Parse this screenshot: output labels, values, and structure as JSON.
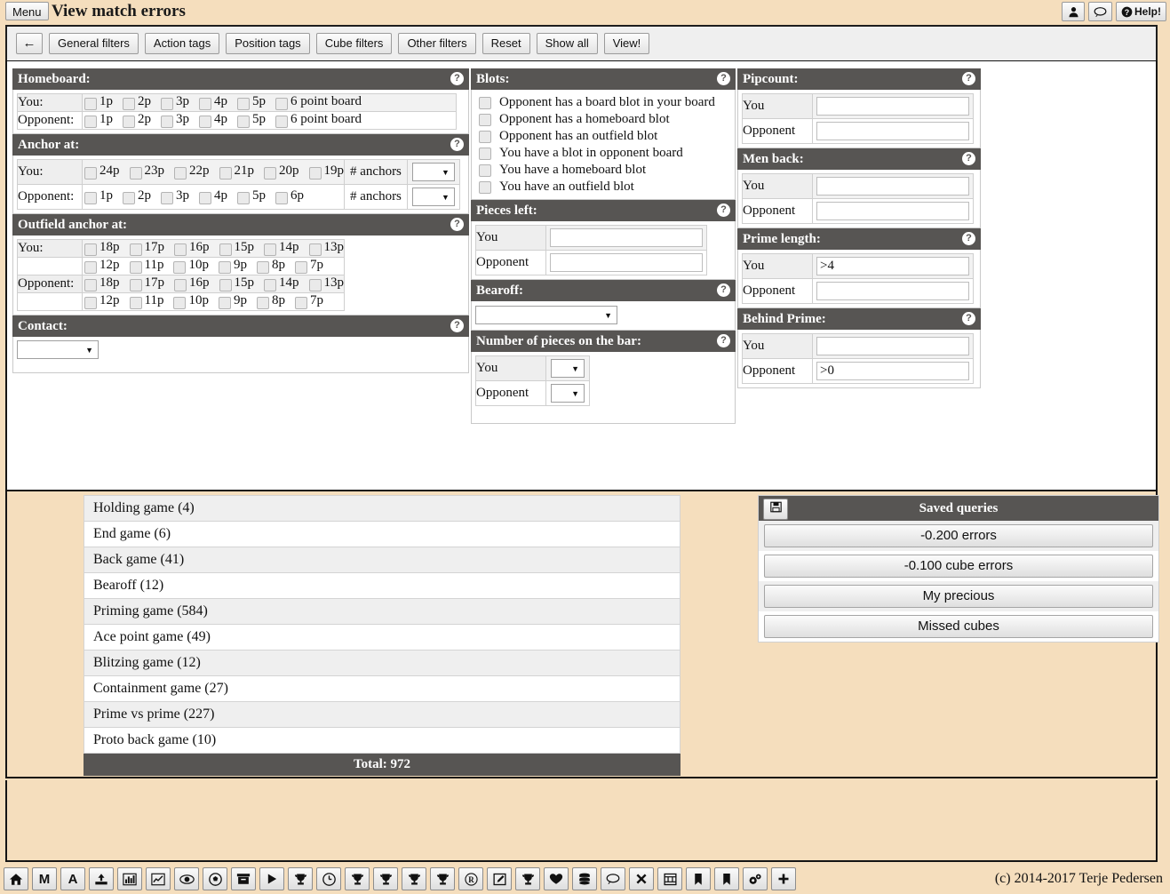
{
  "window": {
    "menu_label": "Menu",
    "title": "View match errors",
    "help_label": "Help!",
    "icons": {
      "user": "user-icon",
      "chat": "chat-bubble-icon",
      "help": "question-mark-icon"
    }
  },
  "filterbar": {
    "back_label": "←",
    "buttons": [
      "General filters",
      "Action tags",
      "Position tags",
      "Cube filters",
      "Other filters",
      "Reset",
      "Show all",
      "View!"
    ]
  },
  "sections": {
    "homeboard": {
      "title": "Homeboard:",
      "you_label": "You:",
      "opponent_label": "Opponent:",
      "you_points": [
        "1p",
        "2p",
        "3p",
        "4p",
        "5p",
        "6 point board"
      ],
      "opponent_points": [
        "1p",
        "2p",
        "3p",
        "4p",
        "5p",
        "6 point board"
      ]
    },
    "anchor_at": {
      "title": "Anchor at:",
      "you_label": "You:",
      "opponent_label": "Opponent:",
      "you_points": [
        "24p",
        "23p",
        "22p",
        "21p",
        "20p",
        "19p"
      ],
      "opponent_points": [
        "1p",
        "2p",
        "3p",
        "4p",
        "5p",
        "6p"
      ],
      "anchors_label": "# anchors",
      "you_anchors_value": "",
      "opponent_anchors_value": ""
    },
    "outfield_anchor_at": {
      "title": "Outfield anchor at:",
      "you_label": "You:",
      "opponent_label": "Opponent:",
      "you_row1": [
        "18p",
        "17p",
        "16p",
        "15p",
        "14p",
        "13p"
      ],
      "you_row2": [
        "12p",
        "11p",
        "10p",
        "9p",
        "8p",
        "7p"
      ],
      "opponent_row1": [
        "18p",
        "17p",
        "16p",
        "15p",
        "14p",
        "13p"
      ],
      "opponent_row2": [
        "12p",
        "11p",
        "10p",
        "9p",
        "8p",
        "7p"
      ]
    },
    "contact": {
      "title": "Contact:",
      "value": ""
    },
    "blots": {
      "title": "Blots:",
      "items": [
        "Opponent has a board blot in your board",
        "Opponent has a homeboard blot",
        "Opponent has an outfield blot",
        "You have a blot in opponent board",
        "You have a homeboard blot",
        "You have an outfield blot"
      ]
    },
    "pieces_left": {
      "title": "Pieces left:",
      "you_label": "You",
      "opponent_label": "Opponent",
      "you_value": "",
      "opponent_value": ""
    },
    "bearoff": {
      "title": "Bearoff:",
      "value": ""
    },
    "pieces_on_bar": {
      "title": "Number of pieces on the bar:",
      "you_label": "You",
      "opponent_label": "Opponent",
      "you_value": "",
      "opponent_value": ""
    },
    "pipcount": {
      "title": "Pipcount:",
      "you_label": "You",
      "opponent_label": "Opponent",
      "you_value": "",
      "opponent_value": ""
    },
    "men_back": {
      "title": "Men back:",
      "you_label": "You",
      "opponent_label": "Opponent",
      "you_value": "",
      "opponent_value": ""
    },
    "prime_length": {
      "title": "Prime length:",
      "you_label": "You",
      "opponent_label": "Opponent",
      "you_value": ">4",
      "opponent_value": ""
    },
    "behind_prime": {
      "title": "Behind Prime:",
      "you_label": "You",
      "opponent_label": "Opponent",
      "you_value": "",
      "opponent_value": ">0"
    }
  },
  "game_list": {
    "rows": [
      "Holding game (4)",
      "End game (6)",
      "Back game (41)",
      "Bearoff (12)",
      "Priming game (584)",
      "Ace point game (49)",
      "Blitzing game (12)",
      "Containment game (27)",
      "Prime vs prime (227)",
      "Proto back game (10)"
    ],
    "total": "Total: 972"
  },
  "saved_queries": {
    "title": "Saved queries",
    "save_icon": "floppy-disk-icon",
    "items": [
      "-0.200 errors",
      "-0.100 cube errors",
      "My precious",
      "Missed cubes"
    ]
  },
  "footer": {
    "copyright": "(c) 2014-2017 Terje Pedersen",
    "icons": [
      "home-icon",
      "match-letter-m-icon",
      "analysis-letter-a-icon",
      "upload-icon",
      "bar-chart-icon",
      "line-chart-icon",
      "eye-icon",
      "ball-icon",
      "archive-icon",
      "play-icon",
      "trophy-icon",
      "clock-icon",
      "trophy-icon",
      "trophy-icon",
      "trophy-icon",
      "trophy-icon",
      "registered-icon",
      "edit-icon",
      "trophy-icon",
      "heart-icon",
      "database-icon",
      "chat-bubble-icon",
      "close-x-icon",
      "film-icon",
      "bookmark-icon",
      "bookmark-icon",
      "settings-gears-icon",
      "plus-icon"
    ],
    "letters": {
      "m": "M",
      "a": "A"
    }
  },
  "colors": {
    "page_bg": "#f5debd",
    "header_bar": "#575553",
    "panel_bg": "#ffffff",
    "row_alt": "#efefef"
  }
}
